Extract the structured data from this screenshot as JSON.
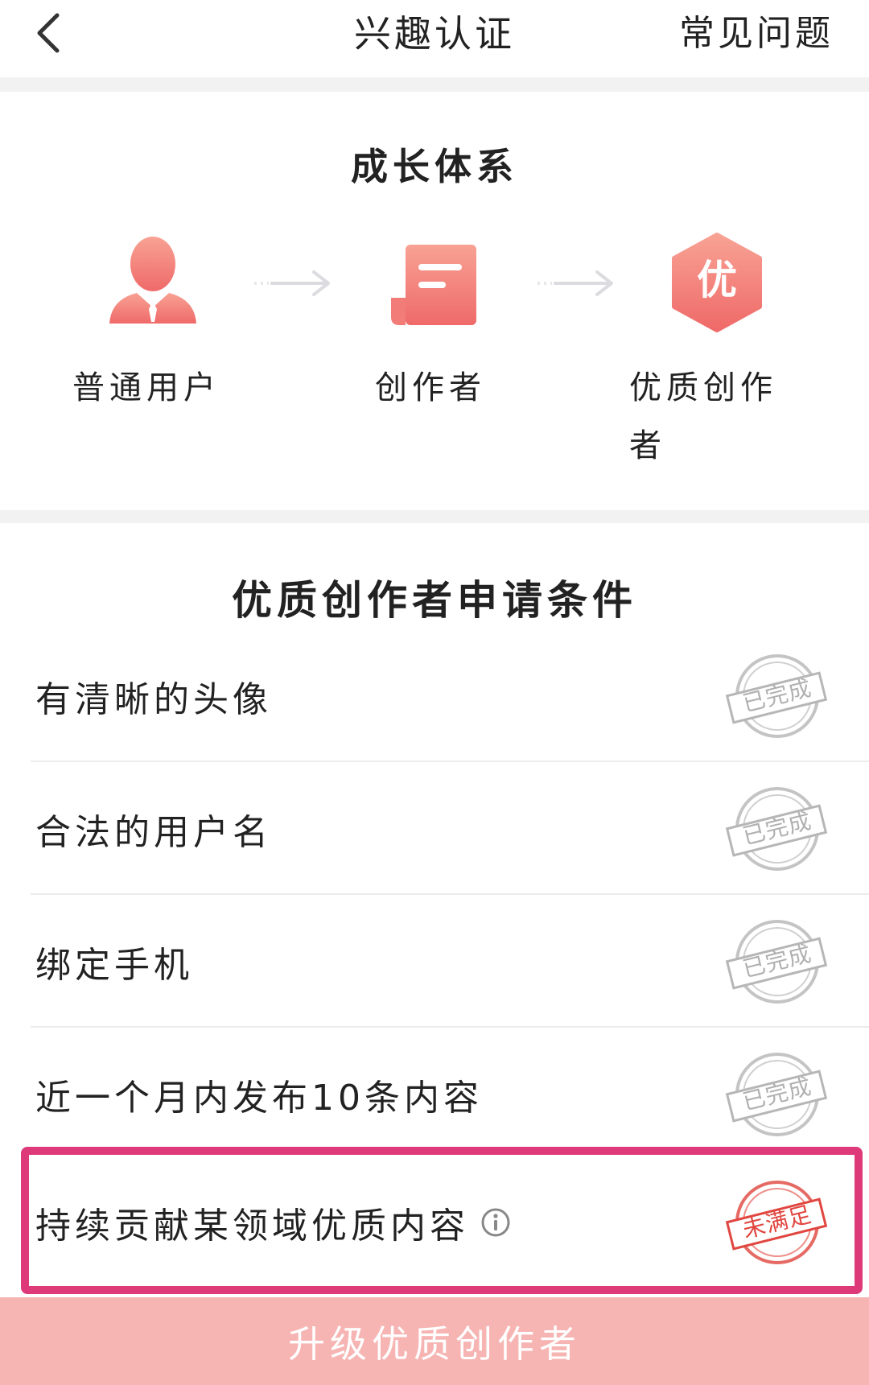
{
  "header": {
    "title": "兴趣认证",
    "faq_label": "常见问题"
  },
  "growth": {
    "title": "成长体系",
    "stages": [
      {
        "label_line1": "普通用户",
        "label_line2": ""
      },
      {
        "label_line1": "创作者",
        "label_line2": ""
      },
      {
        "label_line1": "优质创作",
        "label_line2": "者"
      }
    ],
    "badge_char": "优"
  },
  "conditions": {
    "title": "优质创作者申请条件",
    "items": [
      {
        "label": "有清晰的头像",
        "status": "已完成"
      },
      {
        "label": "合法的用户名",
        "status": "已完成"
      },
      {
        "label": "绑定手机",
        "status": "已完成"
      },
      {
        "label": "近一个月内发布10条内容",
        "status": "已完成"
      },
      {
        "label": "持续贡献某领域优质内容",
        "status": "未满足"
      }
    ]
  },
  "footer": {
    "upgrade_label": "升级优质创作者"
  },
  "colors": {
    "accent": "#f06b6b",
    "highlight": "#de3a7a",
    "button_bg": "#f6b5b3",
    "stamp_done": "#b8b8b8",
    "stamp_fail": "#e0463f"
  }
}
